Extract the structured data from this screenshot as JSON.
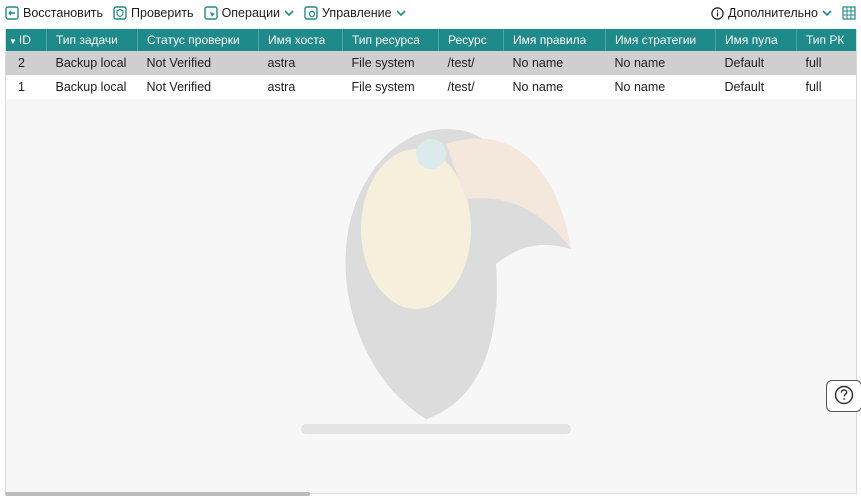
{
  "toolbar": {
    "restore_label": "Восстановить",
    "verify_label": "Проверить",
    "operations_label": "Операции",
    "management_label": "Управление",
    "more_label": "Дополнительно"
  },
  "table": {
    "columns": [
      "ID",
      "Тип задачи",
      "Статус проверки",
      "Имя хоста",
      "Тип ресурса",
      "Ресурс",
      "Имя правила",
      "Имя стратегии",
      "Имя пула",
      "Тип РК"
    ],
    "rows": [
      [
        "2",
        "Backup local",
        "Not Verified",
        "astra",
        "File system",
        "/test/",
        "No name",
        "No name",
        "Default",
        "full"
      ],
      [
        "1",
        "Backup local",
        "Not Verified",
        "astra",
        "File system",
        "/test/",
        "No name",
        "No name",
        "Default",
        "full"
      ]
    ],
    "selected_row": 0
  },
  "colors": {
    "header_bg": "#1f8a8a",
    "selected_row": "#cfcfcf",
    "icon": "#1f8a8a"
  }
}
